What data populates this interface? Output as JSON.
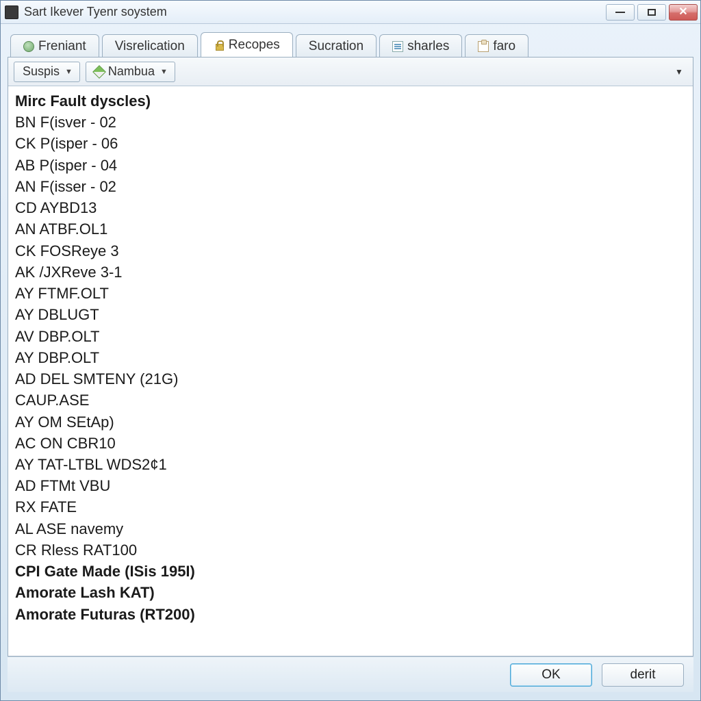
{
  "window": {
    "title": "Sart Ikever Tyenr soystem"
  },
  "tabs": [
    {
      "label": "Freniant",
      "icon": "globe"
    },
    {
      "label": "Visrelication",
      "icon": ""
    },
    {
      "label": "Recopes",
      "icon": "lock",
      "active": true
    },
    {
      "label": "Sucration",
      "icon": ""
    },
    {
      "label": "sharles",
      "icon": "doc"
    },
    {
      "label": "faro",
      "icon": "clip"
    }
  ],
  "toolbar": {
    "filter1": "Suspis",
    "filter2": "Nambua"
  },
  "list": [
    {
      "text": "Mirc Fault dyscles)",
      "bold": true
    },
    {
      "text": "BN F(isver - 02"
    },
    {
      "text": "CK P(isper - 06"
    },
    {
      "text": "AB P(isper - 04"
    },
    {
      "text": "AN F(isser - 02"
    },
    {
      "text": "CD AYBD13"
    },
    {
      "text": "AN ATBF.OL1"
    },
    {
      "text": "CK FOSReye 3"
    },
    {
      "text": "AK /JXReve 3-1"
    },
    {
      "text": "AY FTMF.OLT"
    },
    {
      "text": "AY DBLUGT"
    },
    {
      "text": "AV DBP.OLT"
    },
    {
      "text": "AY DBP.OLT"
    },
    {
      "text": "AD DEL SMTENY (21G)"
    },
    {
      "text": "CAUP.ASE"
    },
    {
      "text": "AY OM SEtAp)"
    },
    {
      "text": "AC ON CBR10"
    },
    {
      "text": "AY TAT-LTBL WDS2¢1"
    },
    {
      "text": "AD FTMt VBU"
    },
    {
      "text": "RX FATE"
    },
    {
      "text": "AL ASE navemy"
    },
    {
      "text": "CR Rless RAT100"
    },
    {
      "text": "CPI Gate Made (ISis 195I)",
      "bold": true
    },
    {
      "text": "Amorate Lash KAT)",
      "bold": true
    },
    {
      "text": "Amorate Futuras (RT200)",
      "bold": true
    }
  ],
  "footer": {
    "ok": "OK",
    "cancel": "derit"
  }
}
